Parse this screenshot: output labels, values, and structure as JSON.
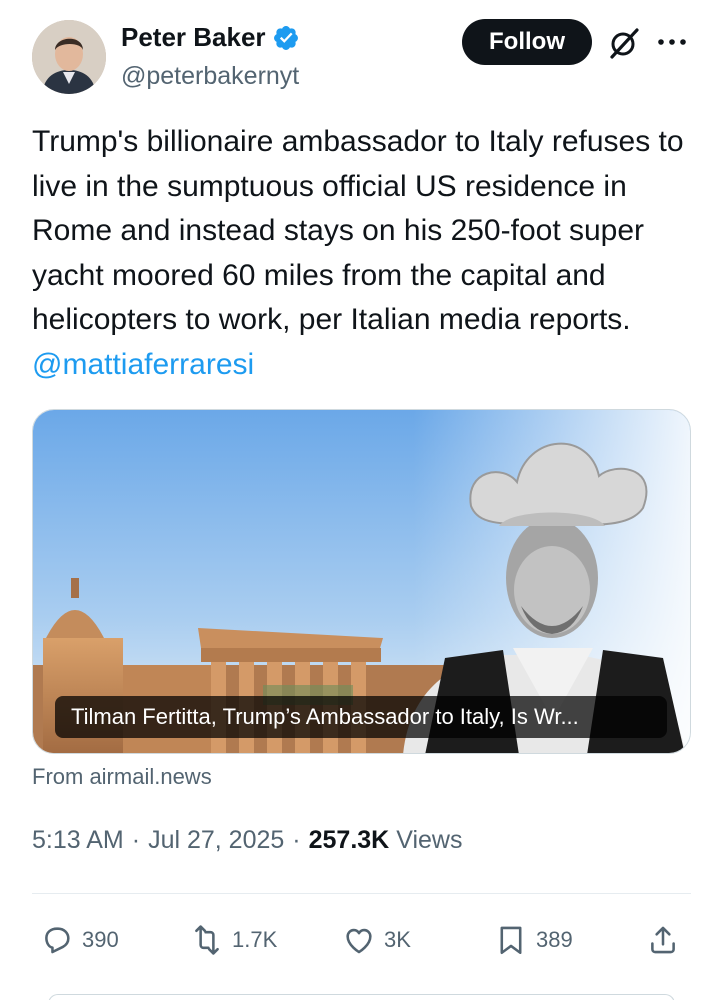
{
  "author": {
    "name": "Peter Baker",
    "handle": "@peterbakernyt",
    "verified": true
  },
  "follow_label": "Follow",
  "tweet": {
    "text": "Trump's billionaire ambassador to Italy refuses to live in the sumptuous official US residence in Rome and instead stays on his 250-foot super yacht moored 60 miles from the capital and helicopters to work, per Italian media reports.",
    "mention": "@mattiaferraresi"
  },
  "link_card": {
    "title": "Tilman Fertitta, Trump’s Ambassador to Italy, Is Wr...",
    "source": "From airmail.news"
  },
  "meta": {
    "time": "5:13 AM",
    "date": "Jul 27, 2025",
    "views_count": "257.3K",
    "views_label": "Views",
    "separator": "·"
  },
  "actions": {
    "replies": "390",
    "reposts": "1.7K",
    "likes": "3K",
    "bookmarks": "389"
  },
  "colors": {
    "accent": "#1d9bf0",
    "text": "#0f1419",
    "secondary": "#536471"
  }
}
